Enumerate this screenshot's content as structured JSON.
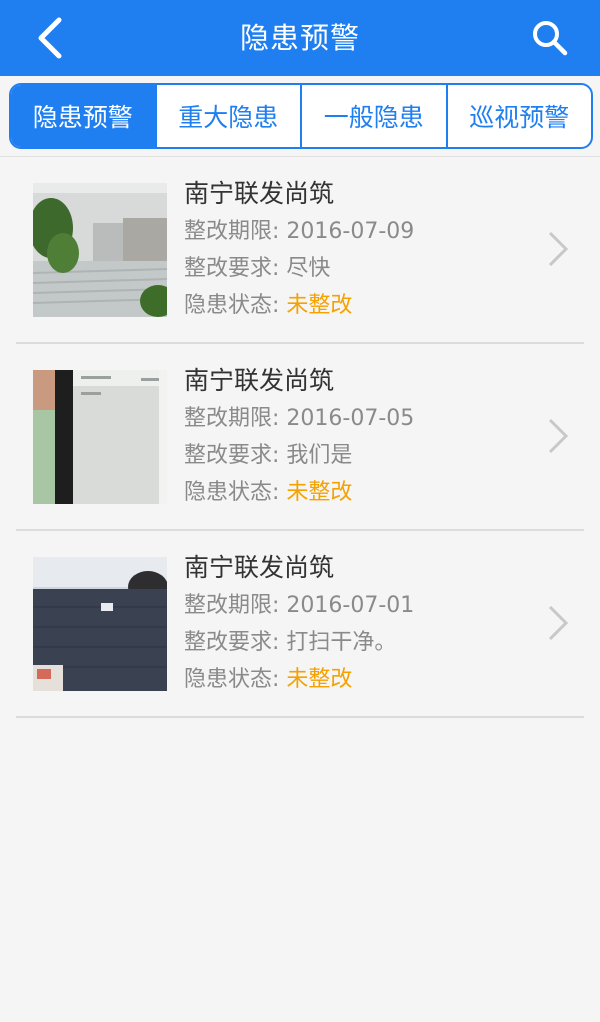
{
  "header": {
    "title": "隐患预警",
    "back_icon": "chevron-left-icon",
    "search_icon": "search-icon",
    "background": "#1f7ff0"
  },
  "tabs": [
    {
      "label": "隐患预警",
      "active": true
    },
    {
      "label": "重大隐患",
      "active": false
    },
    {
      "label": "一般隐患",
      "active": false
    },
    {
      "label": "巡视预警",
      "active": false
    }
  ],
  "items": [
    {
      "name": "南宁联发尚筑",
      "deadline_label": "整改期限: ",
      "deadline": "2016-07-09",
      "requirement_label": "整改要求: ",
      "requirement": "尽快",
      "status_label": "隐患状态: ",
      "status": "未整改"
    },
    {
      "name": "南宁联发尚筑",
      "deadline_label": "整改期限: ",
      "deadline": "2016-07-05",
      "requirement_label": "整改要求: ",
      "requirement": "我们是",
      "status_label": "隐患状态: ",
      "status": "未整改"
    },
    {
      "name": "南宁联发尚筑",
      "deadline_label": "整改期限: ",
      "deadline": "2016-07-01",
      "requirement_label": "整改要求: ",
      "requirement": "打扫干净。",
      "status_label": "隐患状态: ",
      "status": "未整改"
    }
  ],
  "colors": {
    "accent": "#1f7ff0",
    "status_pending": "#f5a100",
    "text_secondary": "#8a8a8a"
  }
}
